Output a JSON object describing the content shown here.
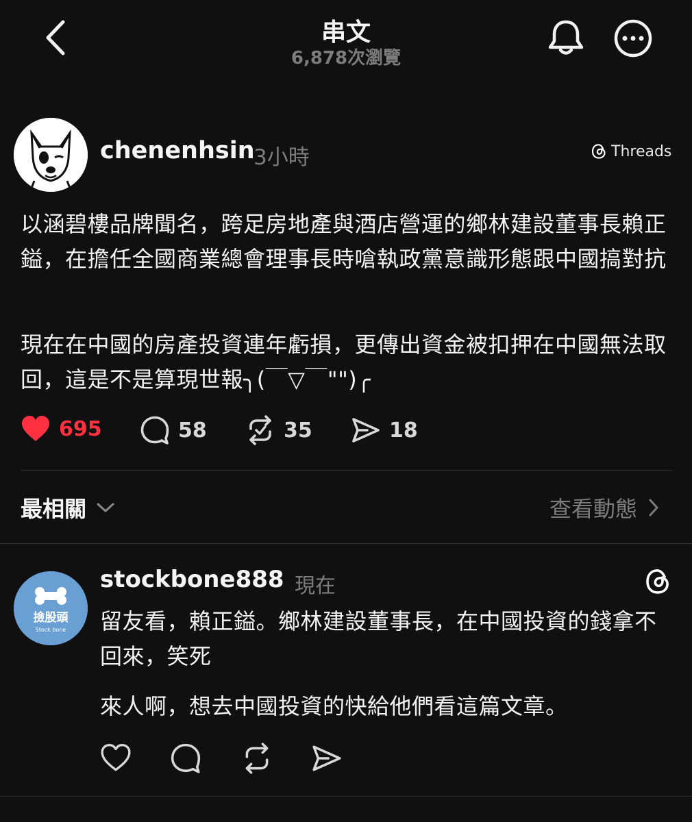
{
  "header": {
    "title": "串文",
    "views": "6,878次瀏覽"
  },
  "post": {
    "username": "chenenhsin",
    "time": "3小時",
    "badge": "Threads",
    "paragraphs": [
      "以涵碧樓品牌聞名，跨足房地產與酒店營運的鄉林建設董事長賴正鎰，在擔任全國商業總會理事長時嗆執政黨意識形態跟中國搞對抗",
      "現在在中國的房產投資連年虧損，更傳出資金被扣押在中國無法取回，這是不是算現世報╮(￣▽￣\"\")╭"
    ],
    "likes": "695",
    "comments": "58",
    "reposts": "35",
    "shares": "18",
    "like_color": "#ff3040"
  },
  "replies_bar": {
    "sort_label": "最相關",
    "activity_label": "查看動態"
  },
  "reply": {
    "username": "stockbone888",
    "time": "現在",
    "avatar_color": "#6a9fd4",
    "avatar_text": "撿股頭",
    "avatar_subtext": "Stock bone",
    "paragraphs": [
      "留友看，賴正鎰。鄉林建設董事長，在中國投資的錢拿不回來，笑死",
      "來人啊，想去中國投資的快給他們看這篇文章。"
    ]
  },
  "icons": {
    "back": "chevron-left-icon",
    "bell": "bell-icon",
    "more": "more-icon",
    "threads": "threads-logo-icon",
    "like": "heart-icon",
    "comment": "comment-icon",
    "repost": "repost-icon",
    "share": "share-icon"
  }
}
